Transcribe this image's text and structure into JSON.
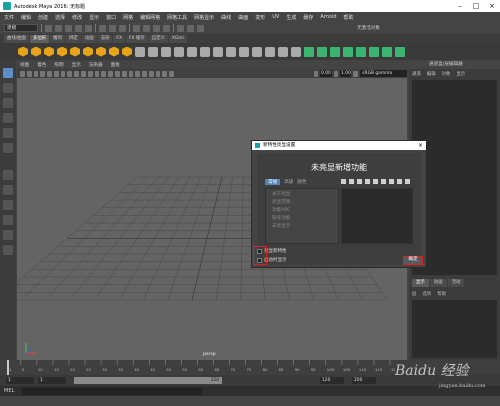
{
  "window": {
    "title": "Autodesk Maya 2016: 无标题"
  },
  "menubar": {
    "items": [
      "文件",
      "编辑",
      "创建",
      "选择",
      "修改",
      "显示",
      "窗口",
      "网格",
      "编辑网格",
      "网格工具",
      "网格显示",
      "曲线",
      "曲面",
      "变形",
      "UV",
      "生成",
      "缓存",
      "Arnold",
      "帮助"
    ]
  },
  "statusline": {
    "mode_dropdown": "建模",
    "workspace_label": "无激活对象"
  },
  "shelf": {
    "tabs": [
      "曲线/曲面",
      "多边形",
      "雕刻",
      "绑定",
      "动画",
      "渲染",
      "FX",
      "FX 缓存",
      "自定义",
      "XGen"
    ],
    "active_tab": 1
  },
  "panel": {
    "menu": [
      "视图",
      "着色",
      "照明",
      "显示",
      "渲染器",
      "面板"
    ],
    "exposure": "0.00",
    "gamma_value": "1.00",
    "color_space": "sRGB gamma",
    "camera_label": "persp"
  },
  "right_panel": {
    "header": "通道盒/层编辑器",
    "menu": [
      "通道",
      "编辑",
      "对象",
      "显示"
    ],
    "layer_tabs": [
      "显示",
      "动画",
      "活动"
    ],
    "layer_menu": [
      "层",
      "选项",
      "帮助"
    ]
  },
  "dialog": {
    "title": "新特性亮显设置",
    "heading": "未亮显新增功能",
    "tabs": [
      "常规",
      "高级",
      "颜色"
    ],
    "list_items": [
      "关于亮显",
      "亮显范围",
      "功能ARC",
      "隐身功能",
      "未亮显示"
    ],
    "checkboxes": [
      "亮显新特性",
      "启动时显示"
    ],
    "ok_button": "确定"
  },
  "timeline": {
    "ticks": [
      "1",
      "5",
      "10",
      "15",
      "20",
      "25",
      "30",
      "35",
      "40",
      "45",
      "50",
      "55",
      "60",
      "65",
      "70",
      "75",
      "80",
      "85",
      "90",
      "95",
      "100",
      "105",
      "110",
      "115",
      "120"
    ],
    "start_field": "1",
    "current_field": "1",
    "range_label": "120",
    "range_end": "120",
    "end_field": "120",
    "max_field": "200"
  },
  "command_line": {
    "label": "MEL"
  },
  "watermark": {
    "brand": "Baidu 经验",
    "url": "jingyan.baidu.com"
  },
  "colors": {
    "highlight_red": "#e02020",
    "accent_blue": "#5083b8",
    "poly_orange": "#e8a419"
  }
}
